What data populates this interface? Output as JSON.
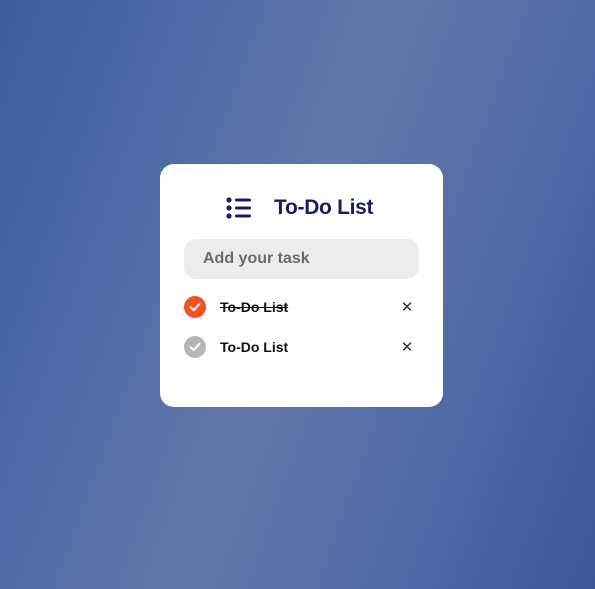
{
  "app": {
    "title": "To-Do List",
    "title_icon": "list-icon",
    "accent_color": "#f4511e",
    "title_color": "#1a1a6b"
  },
  "input": {
    "placeholder": "Add your task",
    "value": ""
  },
  "tasks": [
    {
      "text": "To-Do List",
      "completed": true,
      "check_icon": "checkmark-icon",
      "delete_icon": "close-icon",
      "delete_glyph": "✕"
    },
    {
      "text": "To-Do List",
      "completed": false,
      "check_icon": "checkmark-icon",
      "delete_icon": "close-icon",
      "delete_glyph": "✕"
    }
  ]
}
